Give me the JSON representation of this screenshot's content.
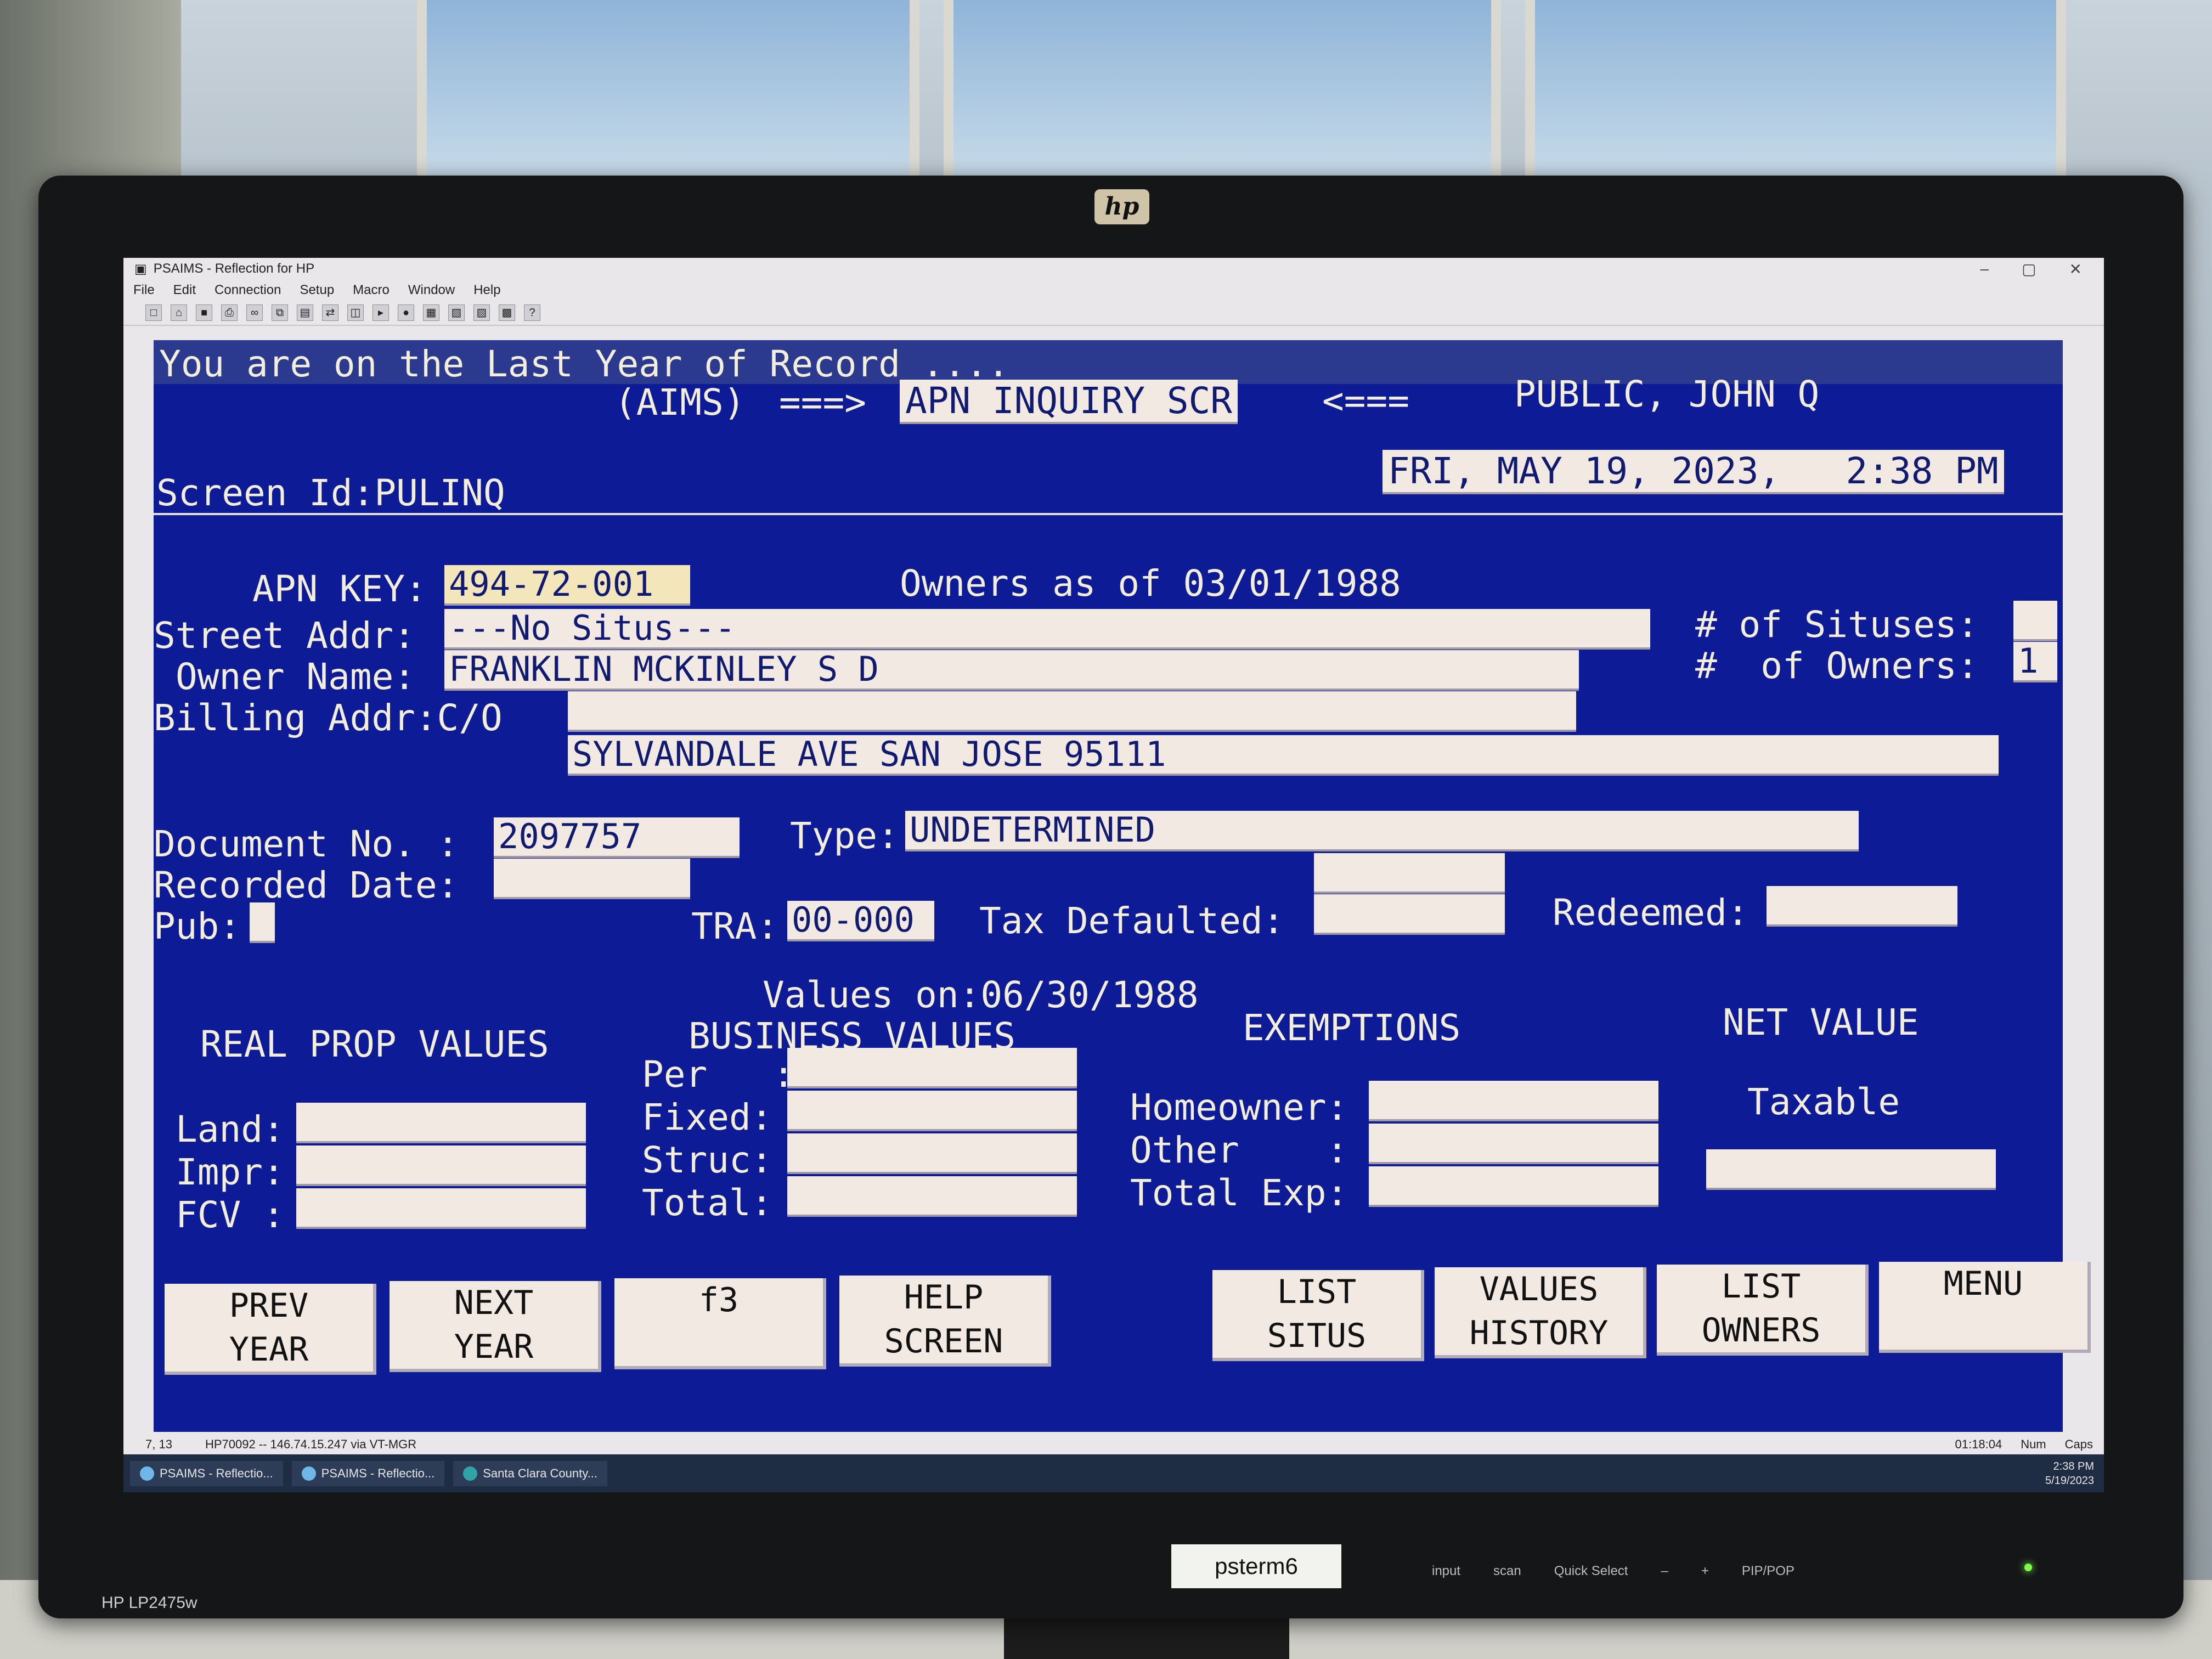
{
  "window": {
    "title": "PSAIMS - Reflection for HP",
    "controls": [
      "–",
      "▢",
      "✕"
    ],
    "menu": [
      "File",
      "Edit",
      "Connection",
      "Setup",
      "Macro",
      "Window",
      "Help"
    ],
    "toolbar_icons": [
      "new-icon",
      "open-icon",
      "save-icon",
      "print-icon",
      "binoculars-icon",
      "copy-icon",
      "paste-icon",
      "transfer-icon",
      "mode-icon",
      "play-icon",
      "record-icon",
      "screen1-icon",
      "screen2-icon",
      "screen3-icon",
      "screen4-icon",
      "help-icon"
    ]
  },
  "terminal": {
    "banner": "You are on the Last Year of Record ....",
    "system": "(AIMS)",
    "arrow_right": "===>",
    "screen_title": "APN INQUIRY SCR",
    "arrow_left": "<===",
    "user": "PUBLIC, JOHN Q",
    "screen_id_label": "Screen Id:PULINQ",
    "datetime": "FRI, MAY 19, 2023,   2:38 PM",
    "apn_label": "APN KEY:",
    "apn_value": "494-72-001",
    "owners_as_of": "Owners as of 03/01/1988",
    "street_label": "Street Addr:",
    "street_value": "---No Situs---",
    "owner_label": "Owner Name:",
    "owner_value": "FRANKLIN MCKINLEY S D",
    "billing_label": "Billing Addr:C/O",
    "billing_line1": "",
    "billing_line2": "SYLVANDALE AVE SAN JOSE 95111",
    "situses_label": "# of Situses:",
    "situses_value": "",
    "owners_label": "#  of Owners:",
    "owners_value": "1",
    "doc_label": "Document No. :",
    "doc_value": "2097757",
    "type_label": "Type:",
    "type_value": "UNDETERMINED",
    "recorded_label": "Recorded Date:",
    "recorded_value": "",
    "pub_label": "Pub:",
    "tra_label": "TRA:",
    "tra_value": "00-000",
    "tax_defaulted_label": "Tax Defaulted:",
    "redeemed_label": "Redeemed:",
    "values_on": "Values on:06/30/1988",
    "real_prop_header": "REAL PROP VALUES",
    "business_header": "BUSINESS VALUES",
    "exemptions_header": "EXEMPTIONS",
    "net_value_header": "NET VALUE",
    "land_label": "Land:",
    "impr_label": "Impr:",
    "fcv_label": "FCV :",
    "per_label": "Per   :",
    "fixed_label": "Fixed:",
    "struc_label": "Struc:",
    "total_label": "Total:",
    "homeowner_label": "Homeowner:",
    "other_label": "Other    :",
    "total_exp_label": "Total Exp:",
    "taxable_label": "Taxable"
  },
  "function_keys": [
    {
      "label": "PREV\nYEAR"
    },
    {
      "label": "NEXT\nYEAR"
    },
    {
      "label": "f3"
    },
    {
      "label": "HELP\nSCREEN"
    },
    {
      "label": "LIST\nSITUS"
    },
    {
      "label": "VALUES\nHISTORY"
    },
    {
      "label": "LIST\nOWNERS"
    },
    {
      "label": "MENU"
    }
  ],
  "status": {
    "cursor_pos": "7, 13",
    "connection": "HP70092 -- 146.74.15.247 via VT-MGR",
    "timer": "01:18:04",
    "num": "Num",
    "caps": "Caps"
  },
  "taskbar": {
    "items": [
      "PSAIMS - Reflectio...",
      "PSAIMS - Reflectio...",
      "Santa Clara County..."
    ],
    "time": "2:38 PM",
    "date": "5/19/2023"
  },
  "monitor": {
    "brand": "hp",
    "model": "HP LP2475w",
    "label": "psterm6",
    "controls": [
      "input",
      "scan",
      "Quick Select",
      "–",
      "+",
      "PIP/POP"
    ]
  },
  "colors": {
    "terminal_bg": "#0e1b96",
    "field_bg": "#f1e9e2",
    "text": "#f3eedb"
  }
}
